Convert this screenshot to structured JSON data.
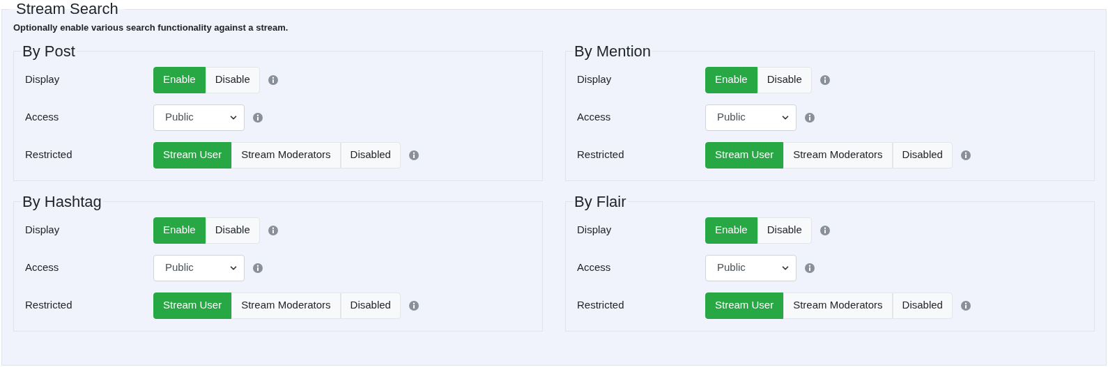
{
  "section": {
    "title": "Stream Search",
    "description": "Optionally enable various search functionality against a stream.",
    "groups": [
      {
        "title": "By Post",
        "rows": [
          {
            "kind": "toggle",
            "label": "Display",
            "options": [
              {
                "label": "Enable",
                "selected": true
              },
              {
                "label": "Disable",
                "selected": false
              }
            ]
          },
          {
            "kind": "select",
            "label": "Access",
            "value": "Public"
          },
          {
            "kind": "toggle",
            "label": "Restricted",
            "options": [
              {
                "label": "Stream User",
                "selected": true
              },
              {
                "label": "Stream Moderators",
                "selected": false
              },
              {
                "label": "Disabled",
                "selected": false
              }
            ]
          }
        ]
      },
      {
        "title": "By Mention",
        "rows": [
          {
            "kind": "toggle",
            "label": "Display",
            "options": [
              {
                "label": "Enable",
                "selected": true
              },
              {
                "label": "Disable",
                "selected": false
              }
            ]
          },
          {
            "kind": "select",
            "label": "Access",
            "value": "Public"
          },
          {
            "kind": "toggle",
            "label": "Restricted",
            "options": [
              {
                "label": "Stream User",
                "selected": true
              },
              {
                "label": "Stream Moderators",
                "selected": false
              },
              {
                "label": "Disabled",
                "selected": false
              }
            ]
          }
        ]
      },
      {
        "title": "By Hashtag",
        "rows": [
          {
            "kind": "toggle",
            "label": "Display",
            "options": [
              {
                "label": "Enable",
                "selected": true
              },
              {
                "label": "Disable",
                "selected": false
              }
            ]
          },
          {
            "kind": "select",
            "label": "Access",
            "value": "Public"
          },
          {
            "kind": "toggle",
            "label": "Restricted",
            "options": [
              {
                "label": "Stream User",
                "selected": true
              },
              {
                "label": "Stream Moderators",
                "selected": false
              },
              {
                "label": "Disabled",
                "selected": false
              }
            ]
          }
        ]
      },
      {
        "title": "By Flair",
        "rows": [
          {
            "kind": "toggle",
            "label": "Display",
            "options": [
              {
                "label": "Enable",
                "selected": true
              },
              {
                "label": "Disable",
                "selected": false
              }
            ]
          },
          {
            "kind": "select",
            "label": "Access",
            "value": "Public"
          },
          {
            "kind": "toggle",
            "label": "Restricted",
            "options": [
              {
                "label": "Stream User",
                "selected": true
              },
              {
                "label": "Stream Moderators",
                "selected": false
              },
              {
                "label": "Disabled",
                "selected": false
              }
            ]
          }
        ]
      }
    ]
  }
}
